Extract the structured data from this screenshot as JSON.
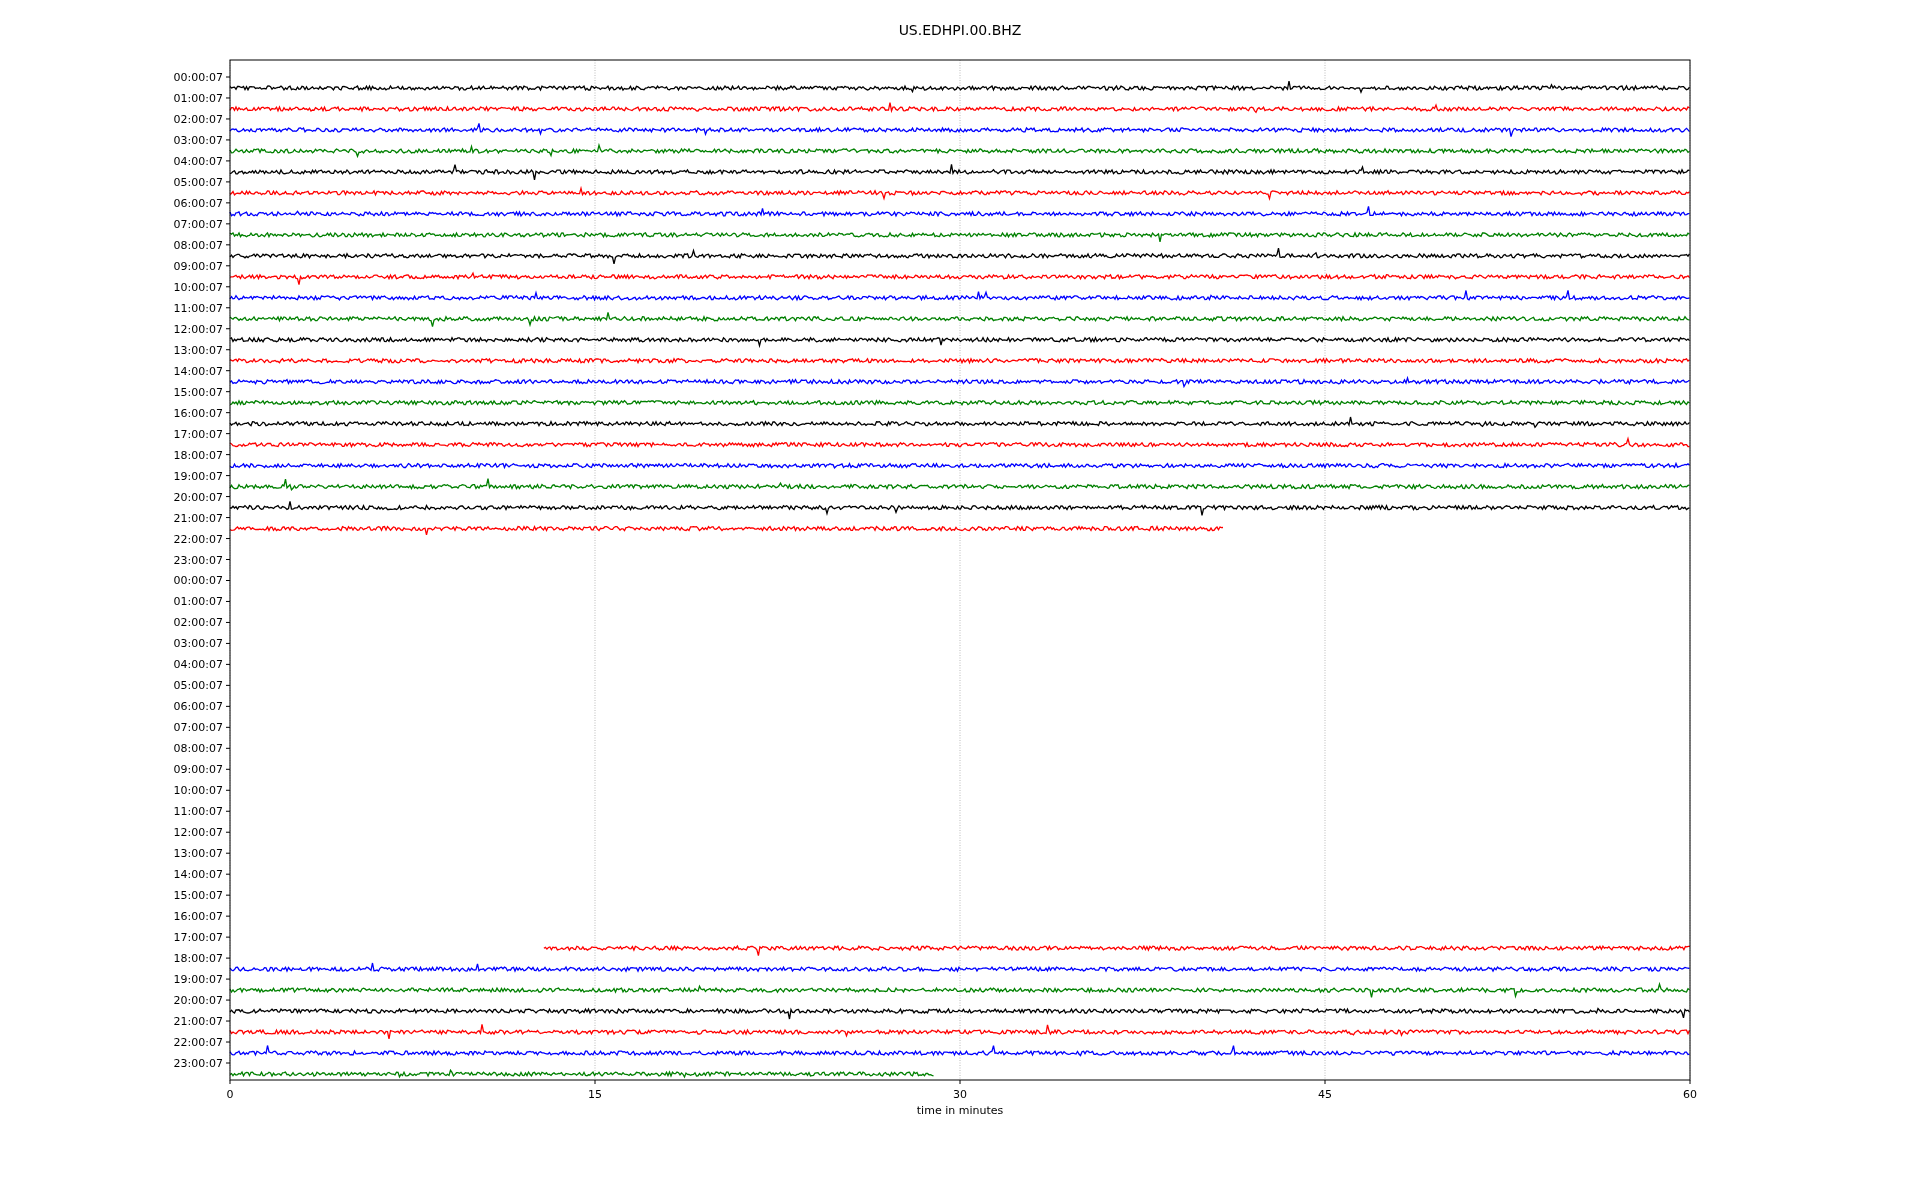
{
  "title": "US.EDHPI.00.BHZ",
  "y_labels": [
    "00:00:07",
    "01:00:07",
    "02:00:07",
    "03:00:07",
    "04:00:07",
    "05:00:07",
    "06:00:07",
    "07:00:07",
    "08:00:07",
    "09:00:07",
    "10:00:07",
    "11:00:07",
    "12:00:07",
    "13:00:07",
    "14:00:07",
    "15:00:07",
    "16:00:07",
    "17:00:07",
    "18:00:07",
    "19:00:07",
    "20:00:07",
    "21:00:07",
    "22:00:07",
    "23:00:07",
    "00:00:07",
    "01:00:07",
    "02:00:07",
    "03:00:07",
    "04:00:07",
    "05:00:07",
    "06:00:07",
    "07:00:07",
    "08:00:07",
    "09:00:07",
    "10:00:07",
    "11:00:07",
    "12:00:07",
    "13:00:07",
    "14:00:07",
    "15:00:07",
    "16:00:07",
    "17:00:07",
    "18:00:07",
    "19:00:07",
    "20:00:07",
    "21:00:07",
    "22:00:07",
    "23:00:07"
  ],
  "x_ticks": [
    "0",
    "15",
    "30",
    "45",
    "60"
  ],
  "xlabel": "time in minutes",
  "traces": [
    {
      "color": "#000000"
    },
    {
      "color": "#ff0000"
    },
    {
      "color": "#0000ff"
    },
    {
      "color": "#008000"
    },
    {
      "color": "#000000"
    },
    {
      "color": "#ff0000"
    },
    {
      "color": "#0000ff"
    },
    {
      "color": "#008000"
    },
    {
      "color": "#000000"
    },
    {
      "color": "#ff0000"
    },
    {
      "color": "#0000ff"
    },
    {
      "color": "#008000"
    },
    {
      "color": "#000000"
    },
    {
      "color": "#ff0000"
    },
    {
      "color": "#0000ff"
    },
    {
      "color": "#008000"
    },
    {
      "color": "#000000"
    },
    {
      "color": "#ff0000"
    },
    {
      "color": "#0000ff"
    },
    {
      "color": "#008000"
    },
    {
      "color": "#000000"
    },
    {
      "color": "#ff0000"
    },
    {
      "color": "#ff0000"
    },
    {
      "color": "#0000ff"
    },
    {
      "color": "#008000"
    },
    {
      "color": "#000000"
    },
    {
      "color": "#ff0000"
    },
    {
      "color": "#0000ff"
    },
    {
      "color": "#008000"
    }
  ]
}
